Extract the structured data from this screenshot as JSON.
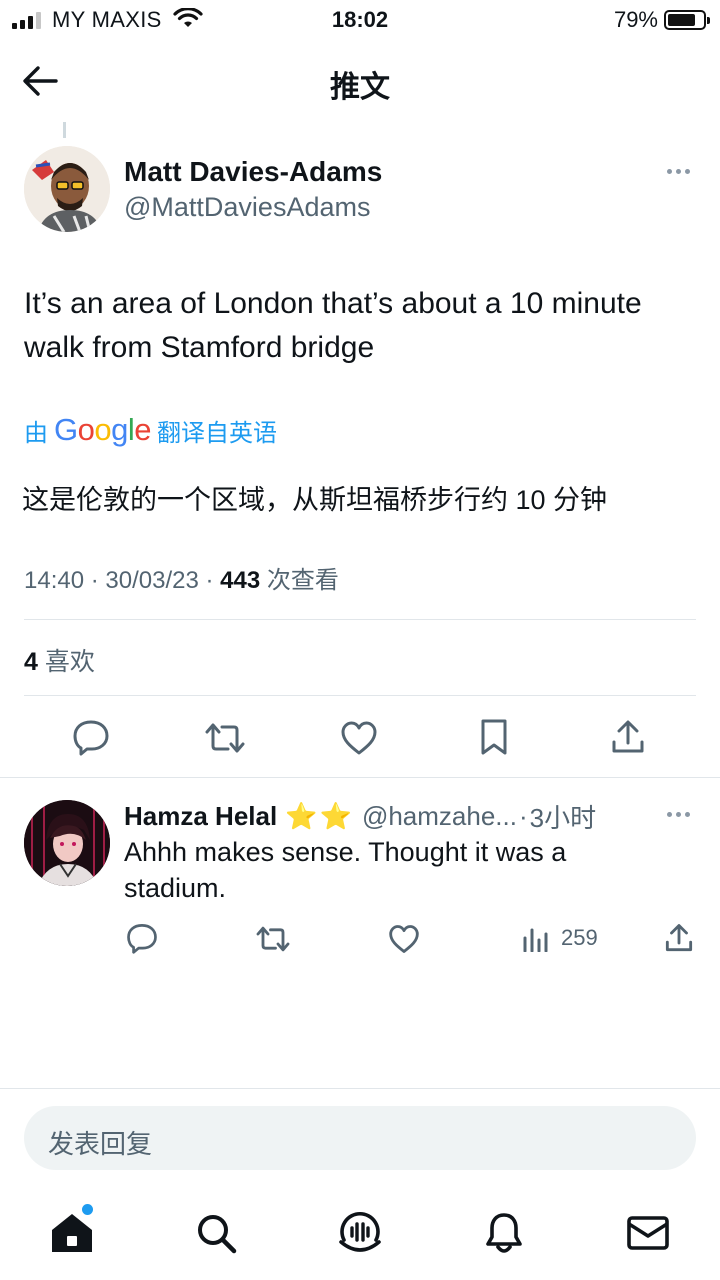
{
  "status_bar": {
    "carrier": "MY MAXIS",
    "time": "18:02",
    "battery_percent": "79%",
    "signal_bars": 4,
    "signal_bars_active": 3,
    "battery_level": 0.79
  },
  "header": {
    "title": "推文",
    "back_icon": "arrow-left-icon"
  },
  "tweet": {
    "author_name": "Matt Davies-Adams",
    "author_handle": "@MattDaviesAdams",
    "text": "It’s an area of London that’s about a 10 minute walk from Stamford bridge",
    "translate_prefix": "由",
    "translate_brand": "Google",
    "translate_suffix": "翻译自英语",
    "translated_text": "这是伦敦的一个区域，从斯坦福桥步行约 10 分钟",
    "time": "14:40",
    "date": "30/03/23",
    "separator": "·",
    "views": "443",
    "views_label": "次查看",
    "likes_count": "4",
    "likes_label": "喜欢",
    "actions": [
      "reply-icon",
      "retweet-icon",
      "like-icon",
      "bookmark-icon",
      "share-icon"
    ]
  },
  "reply": {
    "author_name": "Hamza Helal",
    "stars": "⭐⭐",
    "author_handle": "@hamzahe...",
    "time_ago": "3小时",
    "text": "Ahhh makes sense. Thought it was a stadium.",
    "views": "259",
    "actions": [
      "reply-icon",
      "retweet-icon",
      "like-icon",
      "views-icon",
      "share-icon"
    ]
  },
  "composer": {
    "placeholder": "发表回复"
  },
  "bottom_nav": [
    "home-icon",
    "search-icon",
    "spaces-icon",
    "notifications-icon",
    "messages-icon"
  ],
  "colors": {
    "accent": "#1d9bf0",
    "text_primary": "#0f1419",
    "text_secondary": "#536471",
    "divider": "#e1e6ea"
  }
}
